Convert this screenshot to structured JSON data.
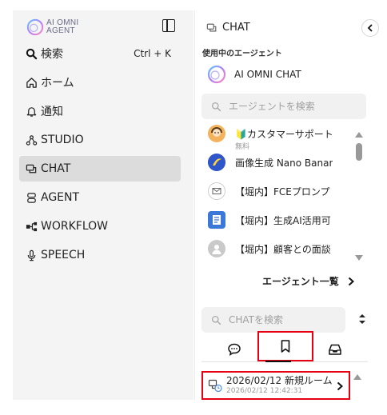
{
  "app": {
    "logo_line1": "AI OMNI",
    "logo_line2": "AGENT"
  },
  "sidebar": {
    "items": [
      {
        "label": "検索",
        "shortcut": "Ctrl + K",
        "icon": "search-icon"
      },
      {
        "label": "ホーム",
        "icon": "home-icon"
      },
      {
        "label": "通知",
        "icon": "bell-icon"
      },
      {
        "label": "STUDIO",
        "icon": "nodes-icon"
      },
      {
        "label": "CHAT",
        "icon": "chat-icon",
        "active": true
      },
      {
        "label": "AGENT",
        "icon": "agent-icon"
      },
      {
        "label": "WORKFLOW",
        "icon": "workflow-icon"
      },
      {
        "label": "SPEECH",
        "icon": "microphone-icon"
      }
    ]
  },
  "chat": {
    "header": "CHAT",
    "section_label": "使用中のエージェント",
    "active_agent": "AI OMNI CHAT",
    "agent_search_placeholder": "エージェントを検索",
    "agents": [
      {
        "name": "🔰カスタマーサポート",
        "sub": "無料",
        "avatar": "support-avatar"
      },
      {
        "name": "画像生成 Nano Banana",
        "avatar": "banana-avatar"
      },
      {
        "name": "【堀内】FCEプロンプト",
        "avatar": "mail-avatar"
      },
      {
        "name": "【堀内】生成AI活用可",
        "avatar": "document-avatar"
      },
      {
        "name": "【堀内】顧客との面談",
        "avatar": "person-avatar"
      }
    ],
    "agent_list_link": "エージェント一覧",
    "chat_search_placeholder": "CHATを検索",
    "tabs": [
      {
        "name": "speech-bubble-icon"
      },
      {
        "name": "bookmark-icon",
        "selected": true
      },
      {
        "name": "inbox-icon"
      }
    ],
    "rooms": [
      {
        "title": "2026/02/12 新規ルーム",
        "time": "2026/02/12 12:42:31"
      }
    ]
  },
  "colors": {
    "highlight": "#e60012",
    "sidebar_bg": "#f4f4f4",
    "active_bg": "#dcdcdc"
  }
}
